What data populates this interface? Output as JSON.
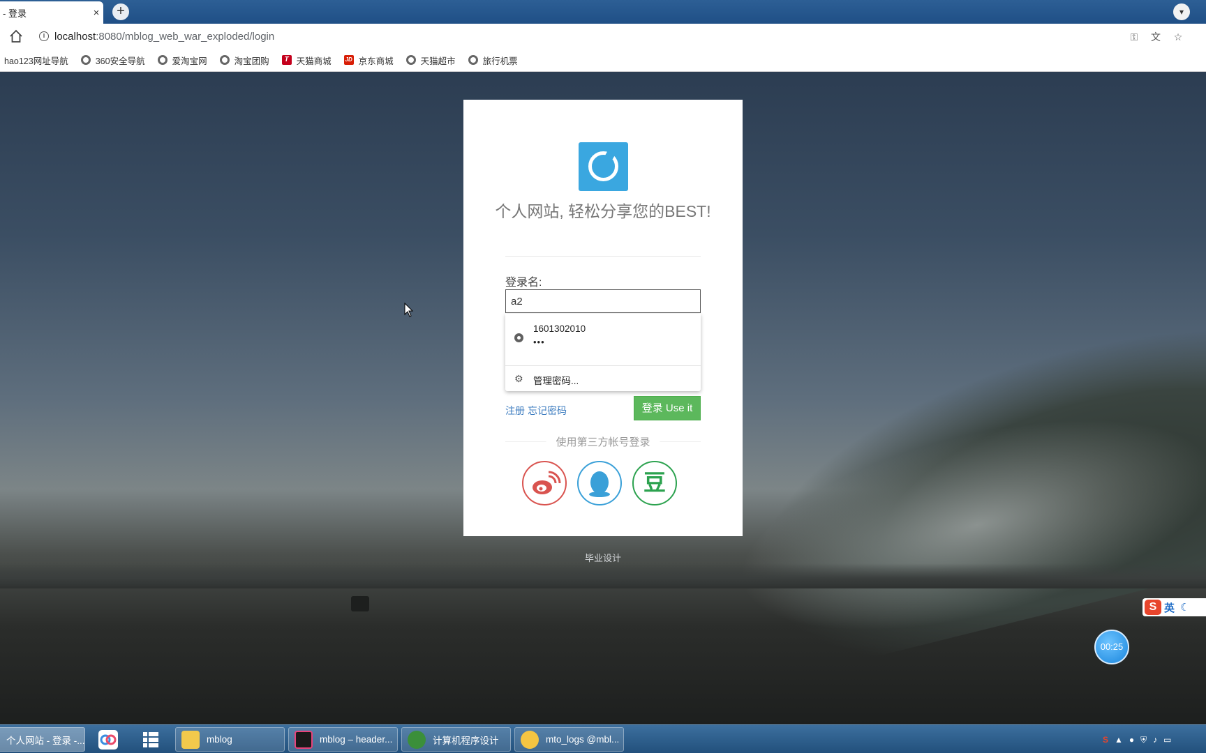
{
  "browser": {
    "tab_title": "- 登录",
    "tab_close": "×",
    "new_tab": "+",
    "url_host": "localhost",
    "url_path": ":8080/mblog_web_war_exploded/login",
    "bookmarks": [
      {
        "label": "hao123网址导航",
        "icon": "none"
      },
      {
        "label": "360安全导航",
        "icon": "globe-icon"
      },
      {
        "label": "爱淘宝网",
        "icon": "globe-icon"
      },
      {
        "label": "淘宝团购",
        "icon": "globe-icon"
      },
      {
        "label": "天猫商城",
        "icon": "tmall-icon"
      },
      {
        "label": "京东商城",
        "icon": "jd-icon"
      },
      {
        "label": "天猫超市",
        "icon": "globe-icon"
      },
      {
        "label": "旅行机票",
        "icon": "globe-icon"
      }
    ],
    "tmall_glyph": "T",
    "jd_glyph": "JD"
  },
  "login": {
    "slogan": "个人网站, 轻松分享您的BEST!",
    "username_label": "登录名:",
    "username_value": "a2",
    "autofill": {
      "saved_username": "1601302010",
      "saved_password_mask": "•••",
      "manage_label": "管理密码..."
    },
    "register_link": "注册",
    "forgot_link": "忘记密码",
    "login_button": "登录 Use it",
    "third_party_label": "使用第三方帐号登录",
    "social": [
      {
        "name": "weibo",
        "color": "#d9534f"
      },
      {
        "name": "qq",
        "color": "#3aa0d8"
      },
      {
        "name": "douban",
        "glyph": "豆",
        "color": "#2ca24f"
      }
    ],
    "accent_color": "#3aa7e0",
    "button_color": "#5cb85c"
  },
  "footer": {
    "text": "毕业设计"
  },
  "widgets": {
    "ime_label": "英",
    "ime_logo": "S",
    "timer": "00:25"
  },
  "taskbar": {
    "items": [
      {
        "label": "个人网站 - 登录 -...",
        "active": true
      },
      {
        "label": "mblog",
        "active": false
      },
      {
        "label": "mblog – header...",
        "active": false
      },
      {
        "label": "计算机程序设计",
        "active": false
      },
      {
        "label": "mto_logs @mbl...",
        "active": false
      }
    ]
  }
}
